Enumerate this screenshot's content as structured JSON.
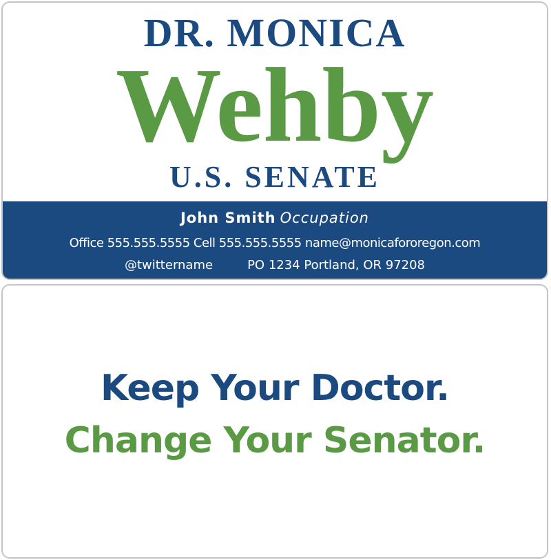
{
  "front": {
    "prefix": "DR. MONICA",
    "surname": "Wehby",
    "office": "U.S. SENATE",
    "contact": {
      "name": "John Smith",
      "occupation": "Occupation",
      "phones_line": "Office 555.555.5555 Cell 555.555.5555 name@monicafororegon.com",
      "twitter": "@twittername",
      "address": "PO 1234 Portland, OR 97208"
    }
  },
  "back": {
    "slogan_line1": "Keep Your Doctor.",
    "slogan_line2": "Change Your Senator."
  },
  "colors": {
    "brand_blue": "#1b4a80",
    "brand_green": "#5b9a44"
  }
}
